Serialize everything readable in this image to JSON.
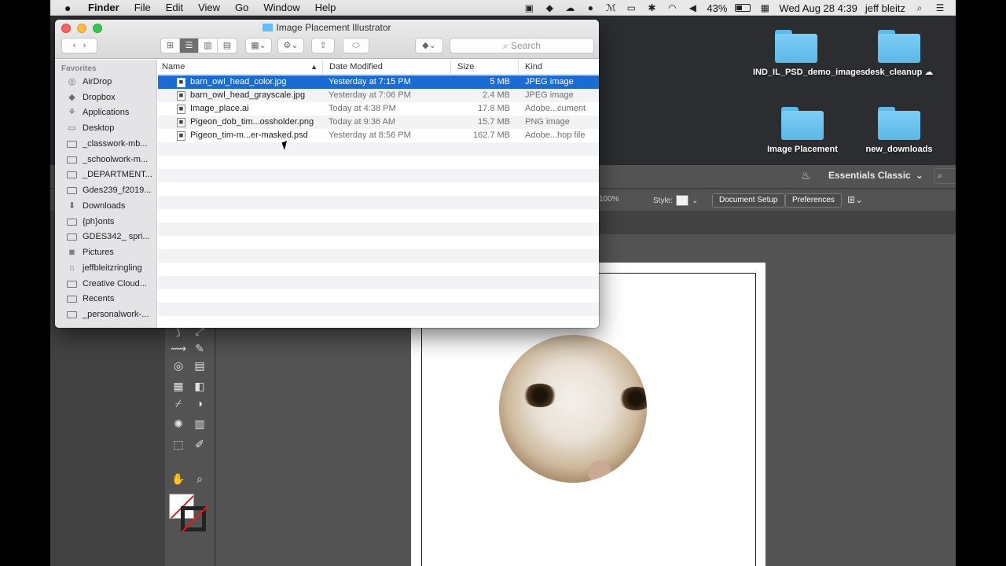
{
  "menubar": {
    "app": "Finder",
    "items": [
      "File",
      "Edit",
      "View",
      "Go",
      "Window",
      "Help"
    ],
    "battery": "43%",
    "datetime": "Wed Aug 28  4:39",
    "user": "jeff bleitz"
  },
  "desktop": {
    "items": [
      {
        "label": "IND_IL_PSD_demo_images"
      },
      {
        "label": "desk_cleanup"
      },
      {
        "label": "Image Placement"
      },
      {
        "label": "new_downloads"
      }
    ]
  },
  "illustrator": {
    "workspace": "Essentials Classic",
    "zoom": "100%",
    "style_label": "Style:",
    "document_setup": "Document Setup",
    "preferences": "Preferences"
  },
  "finder": {
    "title": "Image Placement Illustrator",
    "search_placeholder": "Search",
    "sidebar_heading": "Favorites",
    "sidebar_items": [
      {
        "label": "AirDrop",
        "icon": "airdrop-icon"
      },
      {
        "label": "Dropbox",
        "icon": "dropbox-icon"
      },
      {
        "label": "Applications",
        "icon": "applications-icon"
      },
      {
        "label": "Desktop",
        "icon": "desktop-icon"
      },
      {
        "label": "_classwork-mb...",
        "icon": "folder-icon"
      },
      {
        "label": "_schoolwork-m...",
        "icon": "folder-icon"
      },
      {
        "label": "_DEPARTMENT...",
        "icon": "folder-icon"
      },
      {
        "label": "Gdes239_f2019...",
        "icon": "folder-icon"
      },
      {
        "label": "Downloads",
        "icon": "downloads-icon"
      },
      {
        "label": "{ph}onts",
        "icon": "folder-icon"
      },
      {
        "label": "GDES342_ spri...",
        "icon": "folder-icon"
      },
      {
        "label": "Pictures",
        "icon": "pictures-icon"
      },
      {
        "label": "jeffbleitzringling",
        "icon": "home-icon"
      },
      {
        "label": "Creative Cloud...",
        "icon": "creative-cloud-icon"
      },
      {
        "label": "Recents",
        "icon": "recents-icon"
      },
      {
        "label": "_personalwork-...",
        "icon": "folder-icon"
      }
    ],
    "columns": {
      "name": "Name",
      "date": "Date Modified",
      "size": "Size",
      "kind": "Kind"
    },
    "files": [
      {
        "name": "barn_owl_head_color.jpg",
        "date": "Yesterday at 7:15 PM",
        "size": "5 MB",
        "kind": "JPEG image",
        "selected": true
      },
      {
        "name": "barn_owl_head_grayscale.jpg",
        "date": "Yesterday at 7:06 PM",
        "size": "2.4 MB",
        "kind": "JPEG image",
        "selected": false
      },
      {
        "name": "Image_place.ai",
        "date": "Today at 4:38 PM",
        "size": "17.8 MB",
        "kind": "Adobe...cument",
        "selected": false
      },
      {
        "name": "Pigeon_dob_tim...ossholder.png",
        "date": "Today at 9:36 AM",
        "size": "15.7 MB",
        "kind": "PNG image",
        "selected": false
      },
      {
        "name": "Pigeon_tim-m...er-masked.psd",
        "date": "Yesterday at 8:56 PM",
        "size": "162.7 MB",
        "kind": "Adobe...hop file",
        "selected": false
      }
    ]
  },
  "colors": {
    "selection": "#1a6bd6",
    "folder": "#5cb8e8",
    "ai_panel": "#535353"
  }
}
